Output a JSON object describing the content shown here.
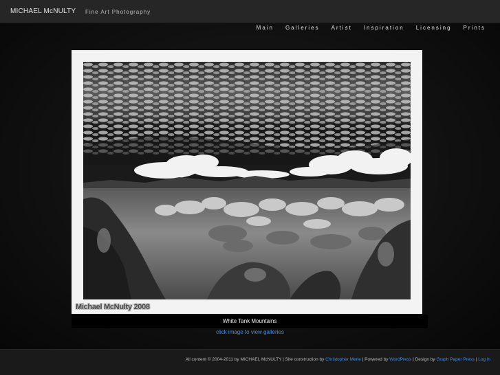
{
  "header": {
    "site_title": "MICHAEL McNULTY",
    "tagline": "Fine Art Photography"
  },
  "nav": {
    "items": [
      "Main",
      "Galleries",
      "Artist",
      "Inspiration",
      "Licensing",
      "Prints"
    ]
  },
  "main": {
    "watermark": "Michael McNulty 2008",
    "caption": "White Tank Mountains",
    "view_link": "click image to view galleries"
  },
  "footer": {
    "copyright": "All content © 2004-2011 by MICHAEL McNULTY",
    "sep1": " | Site construction by ",
    "construction_link": "Christopher Merle",
    "sep2": " | Powered by ",
    "powered_link": "WordPress",
    "sep3": " | Design by ",
    "design_link": "Graph Paper Press",
    "sep4": " | ",
    "login_link": "Log in"
  },
  "colors": {
    "link": "#4a8ee0",
    "header_bg": "#262626",
    "frame": "#f3f3f3"
  }
}
